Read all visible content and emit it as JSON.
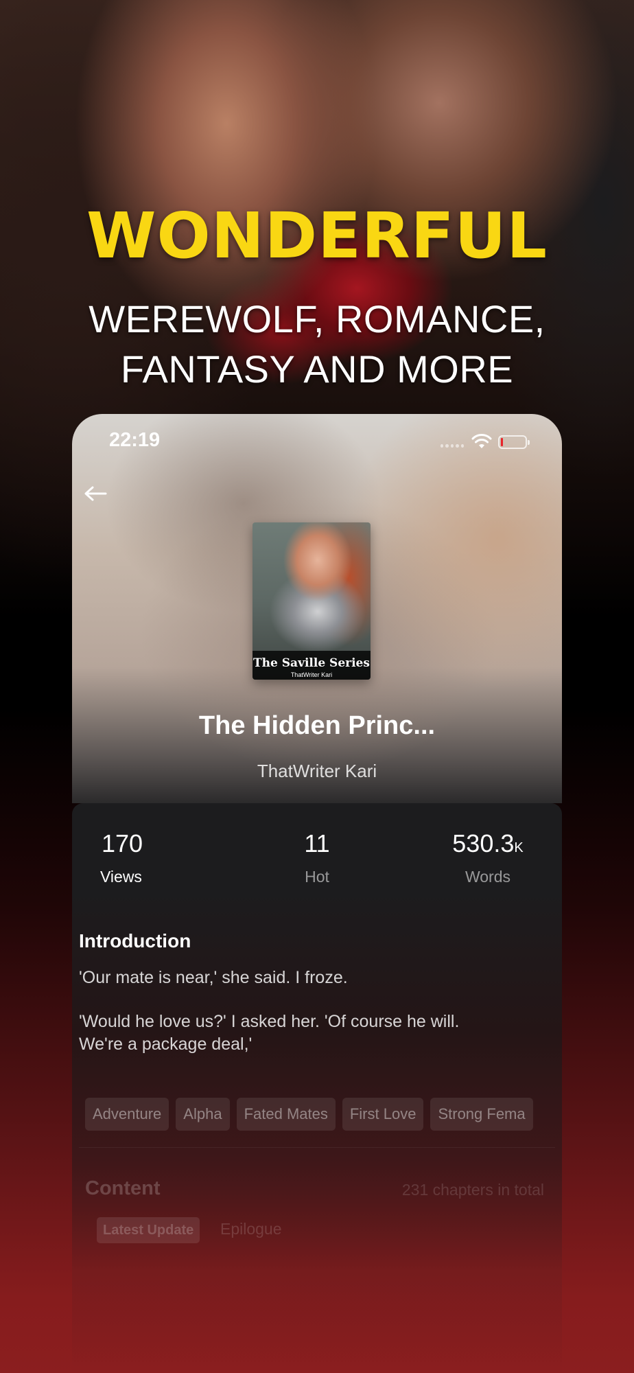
{
  "promo": {
    "headline": "WONDERFUL",
    "subline_1": "WEREWOLF, ROMANCE,",
    "subline_2": "FANTASY AND MORE"
  },
  "status_bar": {
    "time": "22:19",
    "icons": [
      "wifi-icon",
      "battery-icon"
    ]
  },
  "book": {
    "cover_series": "The Saville Series",
    "cover_author": "ThatWriter Kari",
    "title": "The Hidden Princ...",
    "author": "ThatWriter Kari"
  },
  "stats": {
    "views": {
      "value": "170",
      "label": "Views"
    },
    "hot": {
      "value": "11",
      "label": "Hot"
    },
    "words": {
      "value": "530.3",
      "unit": "K",
      "label": "Words"
    }
  },
  "introduction": {
    "title": "Introduction",
    "line_1": "'Our mate is near,' she said. I froze.",
    "line_2": "'Would he love us?' I asked her. 'Of course he will.",
    "line_3": "We're a package deal,'"
  },
  "tags": [
    "Adventure",
    "Alpha",
    "Fated Mates",
    "First Love",
    "Strong Fema"
  ],
  "content": {
    "title": "Content",
    "chapters_total": "231 chapters in total",
    "latest_badge": "Latest Update",
    "latest_chapter": "Epilogue"
  },
  "colors": {
    "headline_yellow": "#f9d713",
    "bottom_red": "#8b1e1f",
    "card_dark": "#1c1c1e"
  }
}
